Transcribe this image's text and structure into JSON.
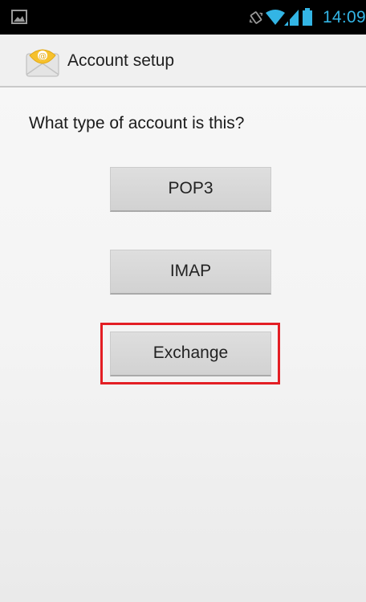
{
  "status_bar": {
    "time": "14:09",
    "time_color": "#33b5e5",
    "left_icon": "image-notification-icon",
    "right_icons": [
      "vibrate-icon",
      "wifi-icon",
      "signal-icon",
      "battery-icon"
    ]
  },
  "action_bar": {
    "app_icon": "email-app-icon",
    "title": "Account setup"
  },
  "content": {
    "question": "What type of account is this?",
    "buttons": [
      {
        "label": "POP3"
      },
      {
        "label": "IMAP"
      },
      {
        "label": "Exchange",
        "highlighted": true
      }
    ],
    "highlight_color": "#e31e24"
  }
}
